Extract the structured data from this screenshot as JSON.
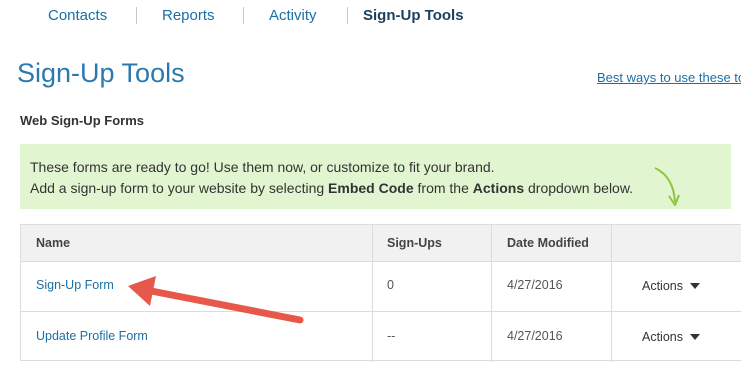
{
  "nav": {
    "items": [
      {
        "label": "Contacts",
        "active": false
      },
      {
        "label": "Reports",
        "active": false
      },
      {
        "label": "Activity",
        "active": false
      },
      {
        "label": "Sign-Up Tools",
        "active": true
      }
    ]
  },
  "page": {
    "title": "Sign-Up Tools",
    "help_link": "Best ways to use these too"
  },
  "section": {
    "title": "Web Sign-Up Forms"
  },
  "banner": {
    "line1": "These forms are ready to go! Use them now, or customize to fit your brand.",
    "line2_prefix": "Add a sign-up form to your website by selecting ",
    "line2_bold1": "Embed Code",
    "line2_mid": " from the ",
    "line2_bold2": "Actions",
    "line2_suffix": " dropdown below.",
    "background": "#e2f5d1",
    "arrow_color": "#8cc63f"
  },
  "table": {
    "columns": [
      "Name",
      "Sign-Ups",
      "Date Modified",
      ""
    ],
    "rows": [
      {
        "name": "Sign-Up Form",
        "signups": "0",
        "date_modified": "4/27/2016",
        "action": "Actions"
      },
      {
        "name": "Update Profile Form",
        "signups": "--",
        "date_modified": "4/27/2016",
        "action": "Actions"
      }
    ]
  },
  "colors": {
    "link": "#1a6fa6",
    "title": "#2a7ab0",
    "annotation_arrow": "#e8584a"
  }
}
